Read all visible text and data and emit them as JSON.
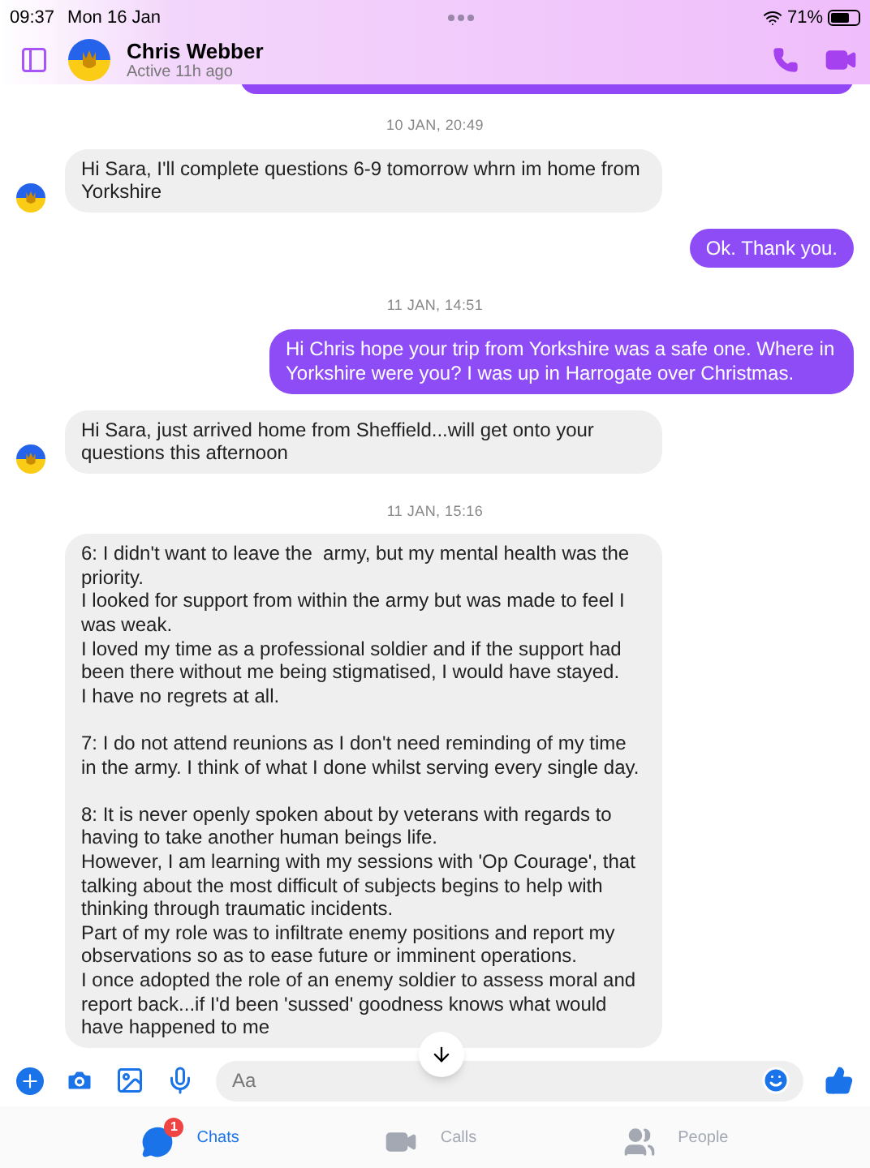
{
  "status_bar": {
    "time": "09:37",
    "date": "Mon 16 Jan",
    "battery_text": "71%"
  },
  "header": {
    "name": "Chris Webber",
    "status": "Active 11h ago"
  },
  "messages": [
    {
      "kind": "timestamp",
      "text": "10 JAN, 20:49"
    },
    {
      "kind": "incoming",
      "text": "Hi Sara, I'll complete questions 6-9 tomorrow whrn im home from Yorkshire",
      "show_avatar": true
    },
    {
      "kind": "outgoing",
      "text": "Ok. Thank you."
    },
    {
      "kind": "timestamp",
      "text": "11 JAN, 14:51"
    },
    {
      "kind": "outgoing",
      "text": "Hi Chris hope your trip from Yorkshire was a safe one. Where in Yorkshire were you? I was up in Harrogate over Christmas."
    },
    {
      "kind": "incoming",
      "text": "Hi Sara, just arrived home from Sheffield...will get onto your questions this afternoon",
      "show_avatar": true
    },
    {
      "kind": "timestamp",
      "text": "11 JAN, 15:16"
    },
    {
      "kind": "incoming",
      "text": "6: I didn't want to leave the  army, but my mental health was the priority.\nI looked for support from within the army but was made to feel I was weak.\nI loved my time as a professional soldier and if the support had been there without me being stigmatised, I would have stayed.\nI have no regrets at all.\n\n7: I do not attend reunions as I don't need reminding of my time in the army. I think of what I done whilst serving every single day.\n\n8: It is never openly spoken about by veterans with regards to having to take another human beings life.\nHowever, I am learning with my sessions with 'Op Courage', that talking about the most difficult of subjects begins to help with thinking through traumatic incidents.\nPart of my role was to infiltrate enemy positions and report my observations so as to ease future or imminent operations.\nI once adopted the role of an enemy soldier to assess moral and report back...if I'd been 'sussed' goodness knows what would have happened to me",
      "show_avatar": false
    }
  ],
  "composer": {
    "placeholder": "Aa"
  },
  "tabs": [
    {
      "label": "Chats",
      "selected": true,
      "badge": "1",
      "kind": "chats"
    },
    {
      "label": "Calls",
      "selected": false,
      "kind": "calls"
    },
    {
      "label": "People",
      "selected": false,
      "kind": "people"
    }
  ]
}
